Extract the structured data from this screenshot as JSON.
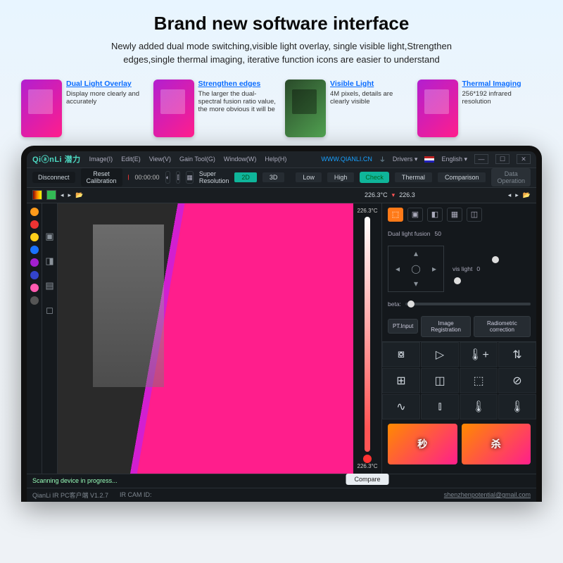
{
  "hero": {
    "title": "Brand new software interface",
    "desc": "Newly added dual mode switching,visible light overlay, single visible light,Strengthen edges,single thermal imaging, iterative function icons are easier to understand"
  },
  "features": [
    {
      "title": "Dual Light Overlay",
      "desc": "Display more clearly and accurately",
      "thumb": "thermal"
    },
    {
      "title": "Strengthen edges",
      "desc": "The larger the dual-spectral fusion ratio value, the more obvious it will be",
      "thumb": "thermal"
    },
    {
      "title": "Visible Light",
      "desc": "4M pixels, details are clearly visible",
      "thumb": "green"
    },
    {
      "title": "Thermal Imaging",
      "desc": "256*192 infrared resolution",
      "thumb": "thermal"
    }
  ],
  "app": {
    "brand": "QiⓐnLi 潜力",
    "menu": [
      "Image(I)",
      "Edit(E)",
      "View(V)",
      "Gain Tool(G)",
      "Window(W)",
      "Help(H)"
    ],
    "site": "WWW.QIANLI.CN",
    "drivers_label": "Drivers ▾",
    "lang_label": "English ▾",
    "window_buttons": [
      "—",
      "☐",
      "✕"
    ]
  },
  "tb1": {
    "disconnect": "Disconnect",
    "reset_cal": "Reset Calibration",
    "time": "00:00:00",
    "super_res": "Super Resolution",
    "d2": "2D",
    "d3": "3D",
    "low": "Low",
    "high": "High",
    "check": "Check",
    "thermal": "Thermal",
    "comparison": "Comparison",
    "data": "Data Operation"
  },
  "tb2": {
    "temp_hi": "226.3°C",
    "temp_lo": "226.3"
  },
  "palette_colors": [
    "#ff9a1a",
    "#e33",
    "#ffcf1a",
    "#1a72ff",
    "#a21fd0",
    "#34c",
    "#ff5ab0",
    "#555"
  ],
  "strip2_icons": [
    "▣",
    "◨",
    "▤",
    "◻"
  ],
  "gauge": {
    "top": "226.3°C",
    "bottom": "226.3°C"
  },
  "compare": "Compare",
  "panel": {
    "modes": [
      "⬚",
      "▣",
      "◧",
      "▦",
      "◫"
    ],
    "fusion_label": "Dual light fusion",
    "fusion_val": "50",
    "vis_label": "vis light",
    "vis_val": "0",
    "beta": "beta:",
    "pt_input": "PT.Input",
    "img_reg": "Image Registration",
    "radio_cal": "Radiometric correction",
    "tools": [
      "⧇",
      "▷",
      "🌡+",
      "⇅",
      "⊞",
      "◫",
      "⬚",
      "⊘",
      "∿",
      "⫾",
      "🌡",
      "🌡"
    ]
  },
  "preview": {
    "a": "秒",
    "b": "杀"
  },
  "status": {
    "scanning": "Scanning device in progress...",
    "ver": "QianLi IR PC客户端  V1.2.7",
    "cam": "IR CAM ID:",
    "mail": "shenzhenpotential@gmail.com"
  }
}
